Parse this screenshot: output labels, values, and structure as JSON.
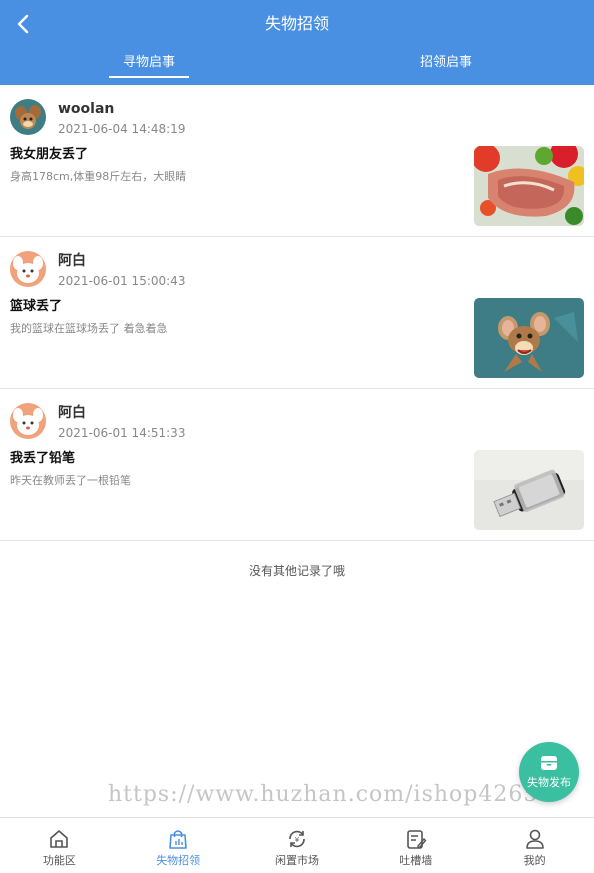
{
  "header": {
    "title": "失物招领",
    "tabs": [
      {
        "label": "寻物启事"
      },
      {
        "label": "招领启事"
      }
    ]
  },
  "posts": [
    {
      "username": "woolan",
      "time": "2021-06-04 14:48:19",
      "title": "我女朋友丢了",
      "desc": "身高178cm,体重98斤左右，大眼睛"
    },
    {
      "username": "阿白",
      "time": "2021-06-01 15:00:43",
      "title": "篮球丢了",
      "desc": "我的篮球在篮球场丢了 着急着急"
    },
    {
      "username": "阿白",
      "time": "2021-06-01 14:51:33",
      "title": "我丢了铅笔",
      "desc": "昨天在教师丢了一根铅笔"
    }
  ],
  "no_more": "没有其他记录了哦",
  "fab": {
    "label": "失物发布"
  },
  "watermark": "https://www.huzhan.com/ishop42659",
  "tabbar": [
    {
      "label": "功能区",
      "icon": "home-icon"
    },
    {
      "label": "失物招领",
      "icon": "bag-icon"
    },
    {
      "label": "闲置市场",
      "icon": "exchange-icon"
    },
    {
      "label": "吐槽墙",
      "icon": "note-edit-icon"
    },
    {
      "label": "我的",
      "icon": "person-icon"
    }
  ],
  "colors": {
    "primary": "#4a90e2",
    "fab": "#3ac0a0"
  }
}
